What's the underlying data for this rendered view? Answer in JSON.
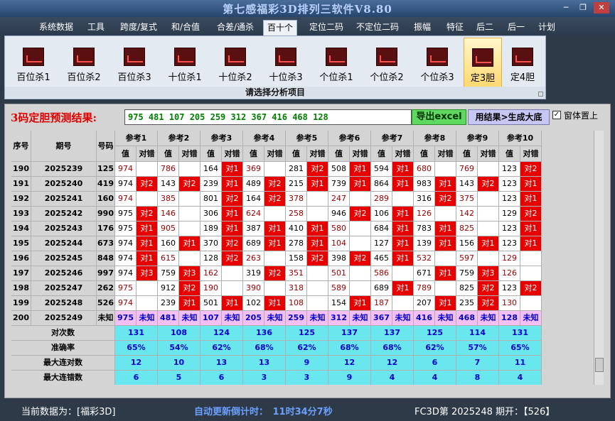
{
  "window": {
    "title": "第七感福彩3D排列三软件V8.80",
    "min_icon": "minimize-icon",
    "max_icon": "maximize-icon",
    "close_icon": "close-icon"
  },
  "menu": [
    "系统数据",
    "工具",
    "跨度/复式",
    "和/合值",
    "合差/通杀",
    "百十个",
    "定位二码",
    "不定位二码",
    "振幅",
    "特征",
    "后二",
    "后一",
    "计划"
  ],
  "menu_active": 5,
  "ribbon": {
    "buttons": [
      "百位杀1",
      "百位杀2",
      "百位杀3",
      "十位杀1",
      "十位杀2",
      "十位杀3",
      "个位杀1",
      "个位杀2",
      "个位杀3",
      "定3胆",
      "定4胆"
    ],
    "selected": 9,
    "caption": "请选择分析项目"
  },
  "prediction": {
    "label": "3码定胆预测结果:",
    "value": "975 481 107 205 259 312 367 416 468 128",
    "excel_button": "导出excel",
    "gen_button": "用结果>生成大底",
    "topmost_label": "窗体置上",
    "topmost_checked": "✓"
  },
  "table": {
    "headers": [
      "序号",
      "期号",
      "号码"
    ],
    "refs": [
      "参考1",
      "参考2",
      "参考3",
      "参考4",
      "参考5",
      "参考6",
      "参考7",
      "参考8",
      "参考9",
      "参考10"
    ],
    "sub": [
      "值",
      "对错"
    ],
    "rows": [
      {
        "no": "190",
        "issue": "2025239",
        "num": "125",
        "cells": [
          [
            "974",
            "",
            0
          ],
          [
            "786",
            "",
            0
          ],
          [
            "164",
            "对1",
            1
          ],
          [
            "369",
            "",
            0
          ],
          [
            "281",
            "对2",
            1
          ],
          [
            "508",
            "对1",
            1
          ],
          [
            "594",
            "对1",
            1
          ],
          [
            "680",
            "",
            0
          ],
          [
            "769",
            "",
            0
          ],
          [
            "123",
            "对2",
            1
          ]
        ]
      },
      {
        "no": "191",
        "issue": "2025240",
        "num": "419",
        "cells": [
          [
            "974",
            "对2",
            1
          ],
          [
            "143",
            "对2",
            1
          ],
          [
            "239",
            "对1",
            1
          ],
          [
            "489",
            "对2",
            1
          ],
          [
            "215",
            "对1",
            1
          ],
          [
            "739",
            "对1",
            1
          ],
          [
            "864",
            "对1",
            1
          ],
          [
            "983",
            "对1",
            1
          ],
          [
            "143",
            "对2",
            1
          ],
          [
            "123",
            "对1",
            1
          ]
        ]
      },
      {
        "no": "192",
        "issue": "2025241",
        "num": "160",
        "cells": [
          [
            "974",
            "",
            0
          ],
          [
            "385",
            "",
            0
          ],
          [
            "801",
            "对2",
            1
          ],
          [
            "164",
            "对2",
            1
          ],
          [
            "378",
            "",
            0
          ],
          [
            "247",
            "",
            0
          ],
          [
            "289",
            "",
            0
          ],
          [
            "316",
            "对2",
            1
          ],
          [
            "375",
            "",
            0
          ],
          [
            "123",
            "对1",
            1
          ]
        ]
      },
      {
        "no": "193",
        "issue": "2025242",
        "num": "990",
        "cells": [
          [
            "975",
            "对2",
            1
          ],
          [
            "146",
            "",
            0
          ],
          [
            "306",
            "对1",
            1
          ],
          [
            "624",
            "",
            0
          ],
          [
            "258",
            "",
            0
          ],
          [
            "946",
            "对2",
            1
          ],
          [
            "106",
            "对1",
            1
          ],
          [
            "126",
            "",
            0
          ],
          [
            "142",
            "",
            0
          ],
          [
            "129",
            "对2",
            1
          ]
        ]
      },
      {
        "no": "194",
        "issue": "2025243",
        "num": "176",
        "cells": [
          [
            "975",
            "对1",
            1
          ],
          [
            "905",
            "",
            0
          ],
          [
            "189",
            "对1",
            1
          ],
          [
            "387",
            "对1",
            1
          ],
          [
            "410",
            "对1",
            1
          ],
          [
            "580",
            "",
            0
          ],
          [
            "684",
            "对1",
            1
          ],
          [
            "783",
            "对1",
            1
          ],
          [
            "825",
            "",
            0
          ],
          [
            "123",
            "对1",
            1
          ]
        ]
      },
      {
        "no": "195",
        "issue": "2025244",
        "num": "673",
        "cells": [
          [
            "974",
            "对1",
            1
          ],
          [
            "160",
            "对1",
            1
          ],
          [
            "370",
            "对2",
            1
          ],
          [
            "689",
            "对1",
            1
          ],
          [
            "278",
            "对1",
            1
          ],
          [
            "104",
            "",
            0
          ],
          [
            "127",
            "对1",
            1
          ],
          [
            "139",
            "对1",
            1
          ],
          [
            "156",
            "对1",
            1
          ],
          [
            "123",
            "对1",
            1
          ]
        ]
      },
      {
        "no": "196",
        "issue": "2025245",
        "num": "848",
        "cells": [
          [
            "974",
            "对1",
            1
          ],
          [
            "615",
            "",
            0
          ],
          [
            "128",
            "对2",
            1
          ],
          [
            "263",
            "",
            0
          ],
          [
            "158",
            "对2",
            1
          ],
          [
            "398",
            "对2",
            1
          ],
          [
            "465",
            "对1",
            1
          ],
          [
            "532",
            "",
            0
          ],
          [
            "597",
            "",
            0
          ],
          [
            "129",
            "",
            0
          ]
        ]
      },
      {
        "no": "197",
        "issue": "2025246",
        "num": "997",
        "cells": [
          [
            "974",
            "对3",
            1
          ],
          [
            "759",
            "对3",
            1
          ],
          [
            "162",
            "",
            0
          ],
          [
            "319",
            "对2",
            1
          ],
          [
            "351",
            "",
            0
          ],
          [
            "501",
            "",
            0
          ],
          [
            "586",
            "",
            0
          ],
          [
            "671",
            "对1",
            1
          ],
          [
            "759",
            "对3",
            1
          ],
          [
            "126",
            "",
            0
          ]
        ]
      },
      {
        "no": "198",
        "issue": "2025247",
        "num": "262",
        "cells": [
          [
            "975",
            "",
            0
          ],
          [
            "912",
            "对2",
            1
          ],
          [
            "190",
            "",
            0
          ],
          [
            "390",
            "",
            0
          ],
          [
            "318",
            "",
            0
          ],
          [
            "589",
            "",
            0
          ],
          [
            "689",
            "对1",
            1
          ],
          [
            "789",
            "",
            0
          ],
          [
            "825",
            "对2",
            1
          ],
          [
            "123",
            "对2",
            1
          ]
        ]
      },
      {
        "no": "199",
        "issue": "2025248",
        "num": "526",
        "cells": [
          [
            "974",
            "",
            0
          ],
          [
            "239",
            "对1",
            1
          ],
          [
            "501",
            "对1",
            1
          ],
          [
            "102",
            "对1",
            1
          ],
          [
            "108",
            "",
            0
          ],
          [
            "154",
            "对1",
            1
          ],
          [
            "187",
            "",
            0
          ],
          [
            "207",
            "对1",
            1
          ],
          [
            "235",
            "对2",
            1
          ],
          [
            "130",
            "",
            0
          ]
        ]
      }
    ],
    "pending": {
      "no": "200",
      "issue": "2025249",
      "num": "未知",
      "values": [
        "975",
        "481",
        "107",
        "205",
        "259",
        "312",
        "367",
        "416",
        "468",
        "128"
      ],
      "status": "未知"
    },
    "stats": [
      {
        "label": "对次数",
        "values": [
          "131",
          "108",
          "124",
          "136",
          "125",
          "137",
          "137",
          "125",
          "114",
          "131"
        ]
      },
      {
        "label": "准确率",
        "values": [
          "65%",
          "54%",
          "62%",
          "68%",
          "62%",
          "68%",
          "68%",
          "62%",
          "57%",
          "65%"
        ]
      },
      {
        "label": "最大连对数",
        "values": [
          "12",
          "10",
          "13",
          "13",
          "9",
          "12",
          "12",
          "6",
          "7",
          "11"
        ]
      },
      {
        "label": "最大连错数",
        "values": [
          "6",
          "5",
          "6",
          "3",
          "3",
          "9",
          "4",
          "4",
          "8",
          "4"
        ]
      }
    ]
  },
  "status": {
    "current": "当前数据为：[福彩3D]",
    "countdown": "自动更新倒计时：　11时34分7秒",
    "issue": "FC3D第 2025248 期开：【526】"
  },
  "colors": {
    "hit": "#e80000",
    "pending": "#f4bff4",
    "stats": "#6ae6ee",
    "accent_red": "#e00000"
  }
}
